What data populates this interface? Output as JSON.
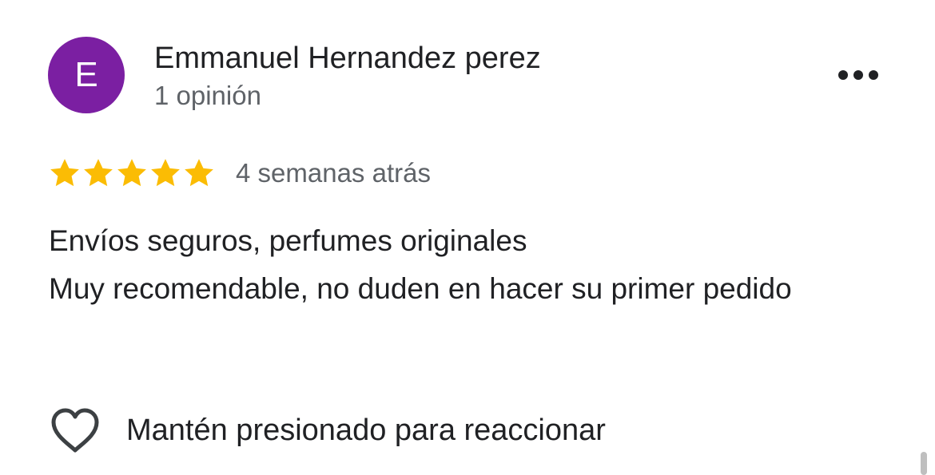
{
  "review": {
    "author": {
      "initial": "E",
      "name": "Emmanuel Hernandez perez",
      "reviews_count_label": "1 opinión",
      "avatar_color": "#7b1fa2"
    },
    "menu_icon": "more-horizontal-icon",
    "rating": {
      "stars": 5,
      "max_stars": 5,
      "star_color": "#fbbc04"
    },
    "time_ago": "4 semanas atrás",
    "text_lines": [
      "Envíos seguros, perfumes originales",
      "Muy recomendable, no duden en hacer su primer pedido"
    ],
    "reaction": {
      "icon": "heart-outline-icon",
      "label": "Mantén presionado para reaccionar"
    }
  }
}
